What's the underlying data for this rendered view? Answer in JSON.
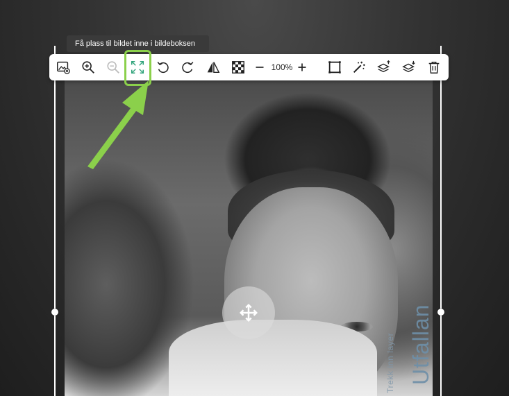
{
  "tooltip": {
    "text": "Få plass til bildet inne i bildeboksen"
  },
  "toolbar": {
    "zoom_level": "100%",
    "buttons": [
      {
        "name": "replace-image-button",
        "icon": "image-remove-icon"
      },
      {
        "name": "zoom-in-button",
        "icon": "zoom-in-icon"
      },
      {
        "name": "zoom-out-button",
        "icon": "zoom-out-icon",
        "disabled": true
      },
      {
        "name": "fit-image-button",
        "icon": "fit-frame-icon",
        "active": true
      },
      {
        "name": "rotate-left-button",
        "icon": "rotate-ccw-icon"
      },
      {
        "name": "rotate-right-button",
        "icon": "rotate-cw-icon"
      },
      {
        "name": "flip-button",
        "icon": "flip-horizontal-icon"
      },
      {
        "name": "transparency-button",
        "icon": "checkerboard-icon"
      },
      {
        "name": "zoom-minus-button",
        "icon": "minus-icon"
      },
      {
        "name": "zoom-plus-button",
        "icon": "plus-icon"
      },
      {
        "name": "frame-button",
        "icon": "crop-frame-icon"
      },
      {
        "name": "magic-wand-button",
        "icon": "magic-wand-icon"
      },
      {
        "name": "bring-forward-button",
        "icon": "layer-up-icon"
      },
      {
        "name": "send-backward-button",
        "icon": "layer-down-icon"
      },
      {
        "name": "delete-button",
        "icon": "trash-icon"
      }
    ]
  },
  "photo": {
    "side_title": "Utfallan",
    "side_subtitle": "Trekk inn layer"
  },
  "colors": {
    "highlight": "#8bd04b",
    "active_icon": "#2fa37a",
    "toolbar_bg": "#ffffff"
  }
}
